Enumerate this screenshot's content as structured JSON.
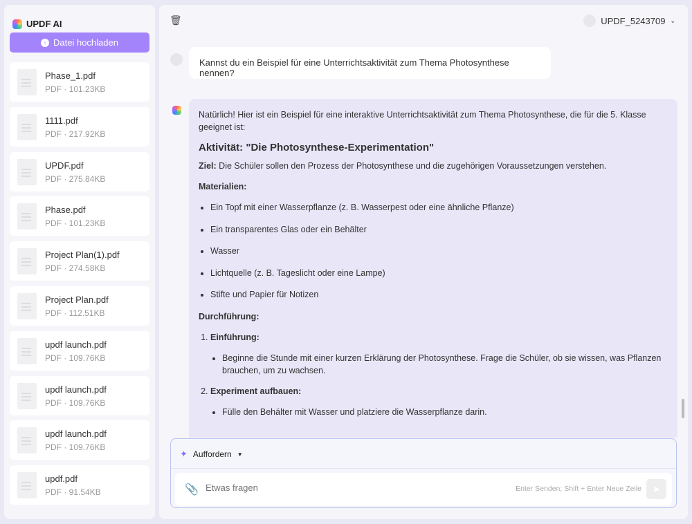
{
  "app": {
    "title": "UPDF AI",
    "upload_label": "Datei hochladen"
  },
  "files": [
    {
      "name": "Phase_1.pdf",
      "meta": "PDF · 101.23KB"
    },
    {
      "name": "1111.pdf",
      "meta": "PDF · 217.92KB"
    },
    {
      "name": "UPDF.pdf",
      "meta": "PDF · 275.84KB"
    },
    {
      "name": "Phase.pdf",
      "meta": "PDF · 101.23KB"
    },
    {
      "name": "Project Plan(1).pdf",
      "meta": "PDF · 274.58KB"
    },
    {
      "name": "Project Plan.pdf",
      "meta": "PDF · 112.51KB"
    },
    {
      "name": "updf launch.pdf",
      "meta": "PDF · 109.76KB"
    },
    {
      "name": "updf launch.pdf",
      "meta": "PDF · 109.76KB"
    },
    {
      "name": "updf launch.pdf",
      "meta": "PDF · 109.76KB"
    },
    {
      "name": "updf.pdf",
      "meta": "PDF · 91.54KB"
    }
  ],
  "header": {
    "user": "UPDF_5243709"
  },
  "chat": {
    "question": "Kannst du ein Beispiel für eine Unterrichtsaktivität zum Thema Photosynthese nennen?",
    "answer": {
      "intro": "Natürlich! Hier ist ein Beispiel für eine interaktive Unterrichtsaktivität zum Thema Photosynthese, die für die 5. Klasse geeignet ist:",
      "title": "Aktivität: \"Die Photosynthese-Experimentation\"",
      "goal_label": "Ziel:",
      "goal": " Die Schüler sollen den Prozess der Photosynthese und die zugehörigen Voraussetzungen verstehen.",
      "materials_label": "Materialien:",
      "materials": [
        "Ein Topf mit einer Wasserpflanze (z. B. Wasserpest oder eine ähnliche Pflanze)",
        "Ein transparentes Glas oder ein Behälter",
        "Wasser",
        "Lichtquelle (z. B. Tageslicht oder eine Lampe)",
        "Stifte und Papier für Notizen"
      ],
      "procedure_label": "Durchführung:",
      "steps": [
        {
          "title": "Einführung:",
          "items": [
            "Beginne die Stunde mit einer kurzen Erklärung der Photosynthese. Frage die Schüler, ob sie wissen, was Pflanzen brauchen, um zu wachsen."
          ]
        },
        {
          "title": "Experiment aufbauen:",
          "items": [
            "Fülle den Behälter mit Wasser und platziere die Wasserpflanze darin."
          ]
        }
      ]
    }
  },
  "input": {
    "prompt_label": "Auffordern",
    "placeholder": "Etwas fragen",
    "hint": "Enter Senden; Shift + Enter Neue Zeile"
  },
  "colors": {
    "accent": "#a384fb",
    "answer_bg": "#e8e6f7"
  }
}
